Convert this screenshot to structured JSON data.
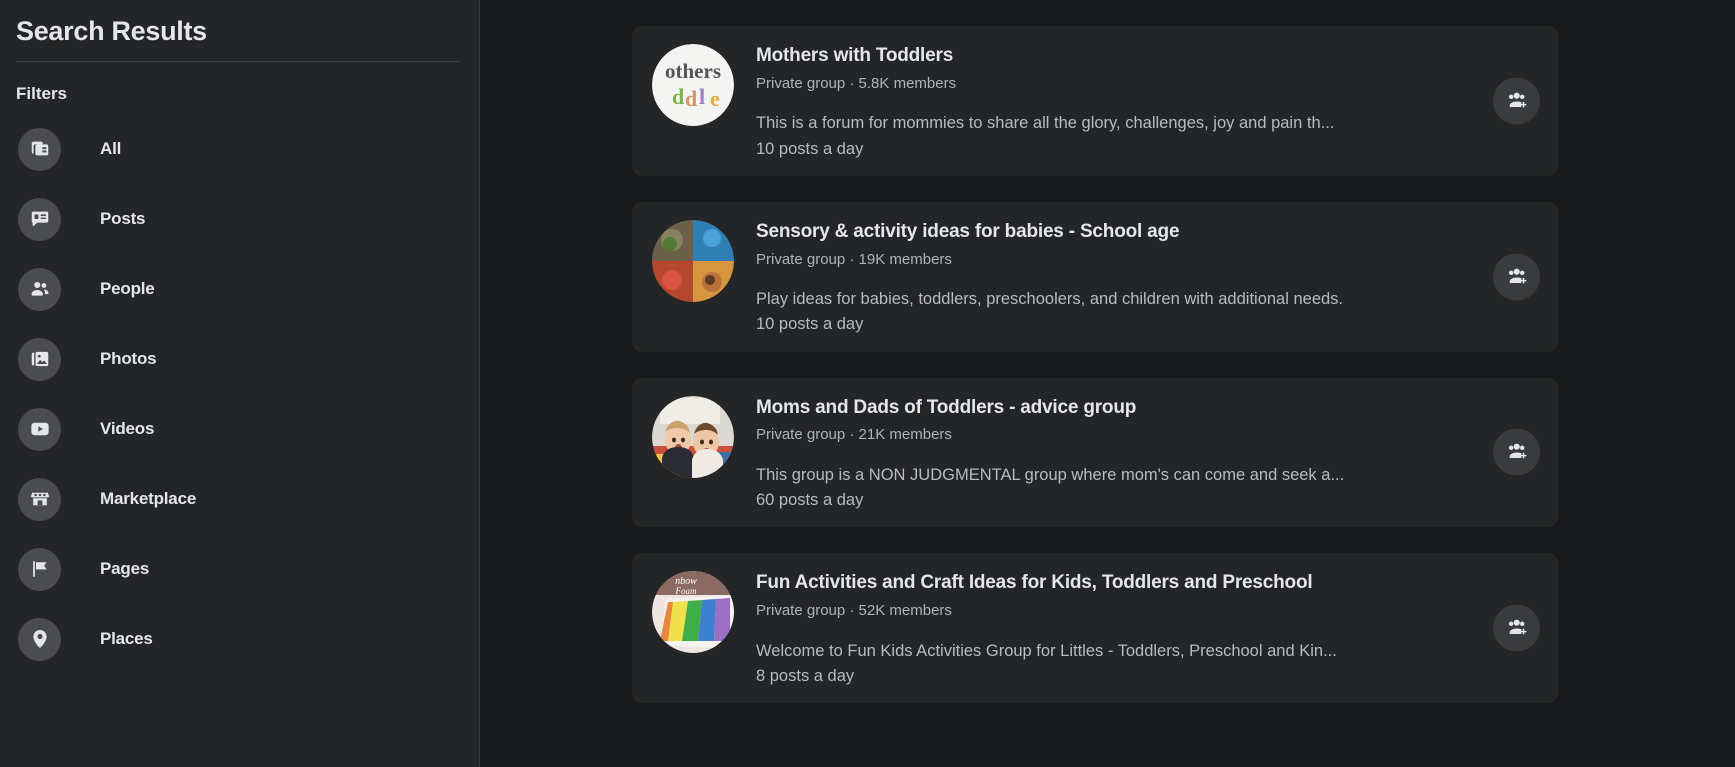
{
  "sidebar": {
    "title": "Search Results",
    "filters_label": "Filters",
    "items": [
      {
        "label": "All",
        "icon": "all-icon"
      },
      {
        "label": "Posts",
        "icon": "posts-icon"
      },
      {
        "label": "People",
        "icon": "people-icon"
      },
      {
        "label": "Photos",
        "icon": "photos-icon"
      },
      {
        "label": "Videos",
        "icon": "videos-icon"
      },
      {
        "label": "Marketplace",
        "icon": "marketplace-icon"
      },
      {
        "label": "Pages",
        "icon": "pages-icon"
      },
      {
        "label": "Places",
        "icon": "places-icon"
      }
    ]
  },
  "results": [
    {
      "name": "Mothers with Toddlers",
      "meta": "Private group · 5.8K members",
      "description": "This is a forum for mommies to share all the glory, challenges, joy and pain th...",
      "posts": "10 posts a day",
      "join_action": "join-group",
      "avatar_kind": "text-logo"
    },
    {
      "name": "Sensory & activity ideas for babies - School age",
      "meta": "Private group · 19K members",
      "description": "Play ideas for babies, toddlers, preschoolers, and children with additional needs.",
      "posts": "10 posts a day",
      "join_action": "join-group",
      "avatar_kind": "collage"
    },
    {
      "name": "Moms and Dads of Toddlers - advice group",
      "meta": "Private group · 21K members",
      "description": "This group is a NON JUDGMENTAL group where mom's can come and seek a...",
      "posts": "60 posts a day",
      "join_action": "join-group",
      "avatar_kind": "kids-photo"
    },
    {
      "name": "Fun Activities and Craft Ideas for Kids, Toddlers and Preschool",
      "meta": "Private group · 52K members",
      "description": "Welcome to Fun Kids Activities Group for Littles - Toddlers, Preschool and Kin...",
      "posts": "8 posts a day",
      "join_action": "join-group",
      "avatar_kind": "rainbow"
    }
  ],
  "colors": {
    "page_background": "#18191a",
    "surface": "#242526",
    "divider": "#3e4042",
    "text_primary": "#e4e6eb",
    "text_secondary": "#b0b3b8",
    "icon_chip": "#4b4c4f"
  }
}
